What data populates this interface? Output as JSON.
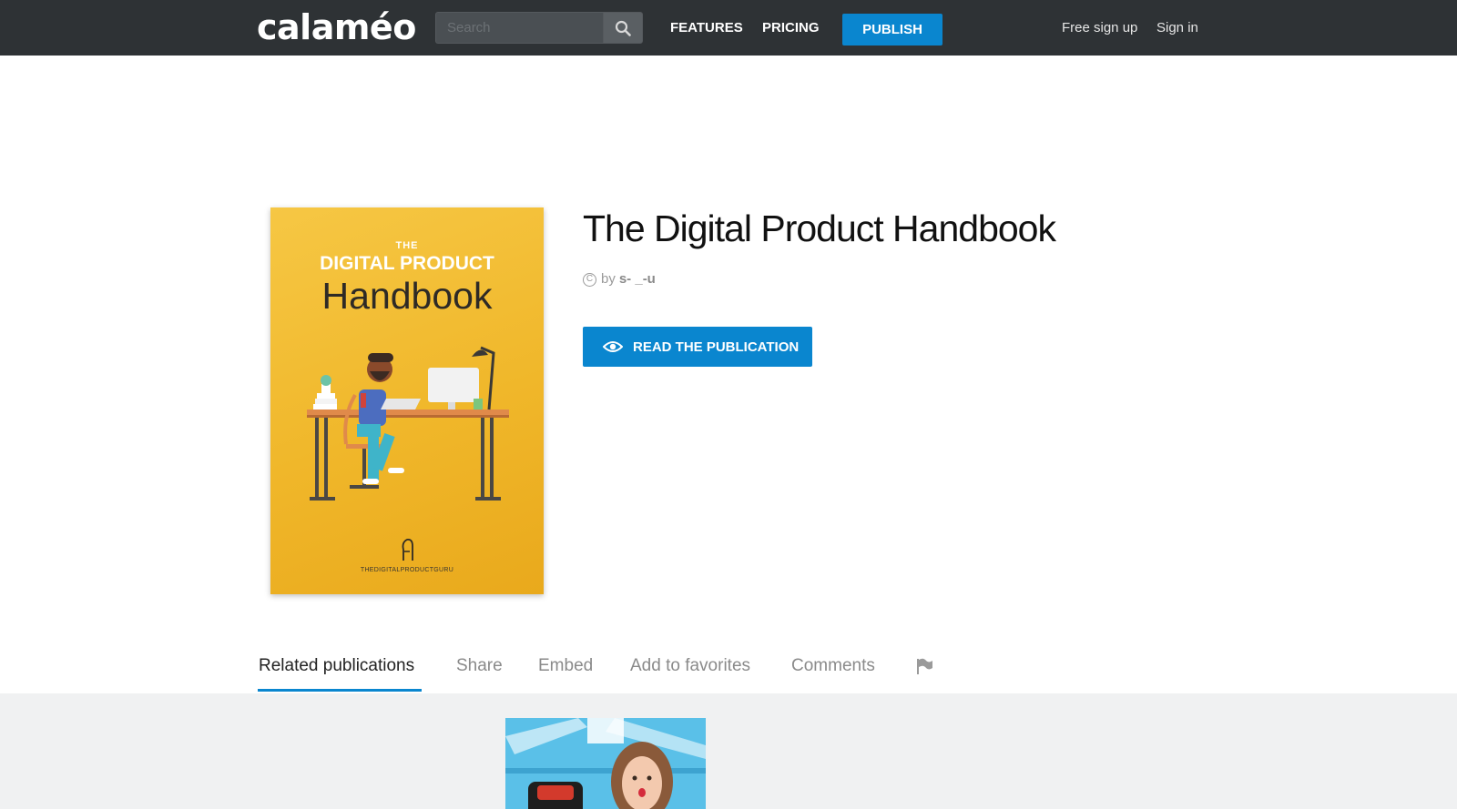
{
  "header": {
    "logo": "calaméo",
    "search_placeholder": "Search",
    "nav": {
      "features": "FEATURES",
      "pricing": "PRICING"
    },
    "publish_label": "PUBLISH",
    "signup_label": "Free sign up",
    "signin_label": "Sign in"
  },
  "publication": {
    "title": "The Digital Product Handbook",
    "by_label": "by",
    "author": "s- _-u",
    "read_label": "READ THE PUBLICATION",
    "cover": {
      "the": "THE",
      "line1": "DIGITAL PRODUCT",
      "line2": "Handbook",
      "footer": "THEDIGITALPRODUCTGURU"
    }
  },
  "tabs": [
    {
      "label": "Related publications",
      "active": true
    },
    {
      "label": "Share"
    },
    {
      "label": "Embed"
    },
    {
      "label": "Add to favorites"
    },
    {
      "label": "Comments"
    }
  ],
  "icons": [
    "search-icon",
    "copyright-icon",
    "eye-icon",
    "flag-icon"
  ],
  "colors": {
    "topbar": "#2e3235",
    "accent": "#0a86cf",
    "cover": "#f2bb30",
    "related_bg": "#f0f1f2"
  }
}
